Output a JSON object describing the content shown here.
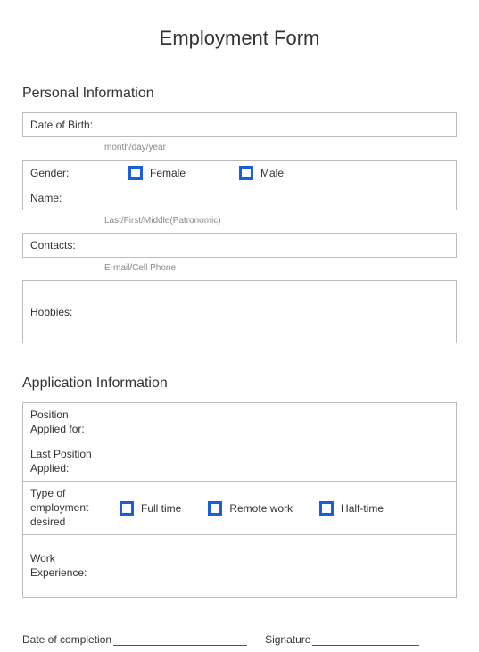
{
  "title": "Employment Form",
  "personal": {
    "header": "Personal Information",
    "dob_label": "Date of Birth:",
    "dob_hint": "month/day/year",
    "gender_label": "Gender:",
    "gender_female": "Female",
    "gender_male": "Male",
    "name_label": "Name:",
    "name_hint": "Last/First/Middle(Patronomic)",
    "contacts_label": "Contacts:",
    "contacts_hint": "E-mail/Cell Phone",
    "hobbies_label": "Hobbies:"
  },
  "application": {
    "header": "Application Information",
    "position_label": "Position Applied for:",
    "last_position_label": "Last Position Applied:",
    "employment_type_label": "Type of employment desired :",
    "fulltime": "Full time",
    "remote": "Remote work",
    "halftime": "Half-time",
    "experience_label": "Work Experience:"
  },
  "footer": {
    "date_label": "Date of completion",
    "signature_label": "Signature"
  }
}
